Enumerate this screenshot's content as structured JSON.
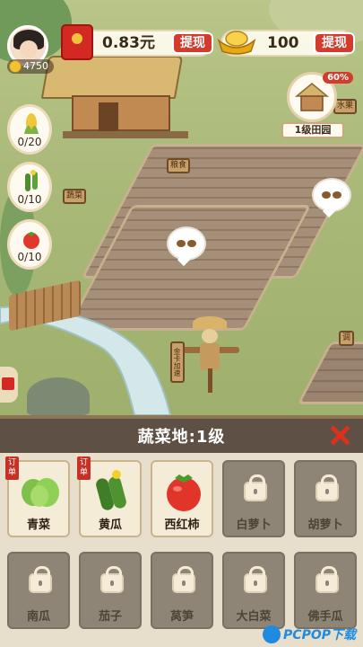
{
  "hud": {
    "gold_count": "4750",
    "cash_amount": "0.83元",
    "cash_withdraw_label": "提现",
    "ingot_amount": "100",
    "ingot_withdraw_label": "提现",
    "crops": [
      {
        "id": "corn",
        "count": "0/20",
        "icon": "corn-icon"
      },
      {
        "id": "cucumber",
        "count": "0/10",
        "icon": "cucumber-icon"
      },
      {
        "id": "tomato",
        "count": "0/10",
        "icon": "tomato-icon"
      }
    ],
    "farm_badge": {
      "percent": "60%",
      "label": "1级田园"
    }
  },
  "scene": {
    "signs": {
      "granary": "粮食",
      "vegetable": "蔬菜",
      "fruit": "水果",
      "scarecrow": "金卡加速",
      "side": "调"
    },
    "colors": {
      "grass": "#a9b978",
      "plot": "#a58f78",
      "water": "#c9e2e6"
    }
  },
  "panel": {
    "title": "蔬菜地:1级",
    "close_icon": "close-icon",
    "order_tag": "订单",
    "crops": [
      {
        "name": "青菜",
        "state": "unlocked",
        "order": true,
        "icon": "bok-choy-icon"
      },
      {
        "name": "黄瓜",
        "state": "unlocked",
        "order": true,
        "icon": "cucumber-icon"
      },
      {
        "name": "西红柿",
        "state": "unlocked",
        "order": false,
        "icon": "tomato-icon"
      },
      {
        "name": "白萝卜",
        "state": "locked",
        "order": false,
        "icon": "radish-icon"
      },
      {
        "name": "胡萝卜",
        "state": "locked",
        "order": false,
        "icon": "carrot-icon"
      },
      {
        "name": "南瓜",
        "state": "locked",
        "order": false,
        "icon": "pumpkin-icon"
      },
      {
        "name": "茄子",
        "state": "locked",
        "order": false,
        "icon": "eggplant-icon"
      },
      {
        "name": "莴笋",
        "state": "locked",
        "order": false,
        "icon": "lettuce-icon"
      },
      {
        "name": "大白菜",
        "state": "locked",
        "order": false,
        "icon": "cabbage-icon"
      },
      {
        "name": "佛手瓜",
        "state": "locked",
        "order": false,
        "icon": "chayote-icon"
      }
    ]
  },
  "watermark": {
    "text": "PCPOP下载"
  }
}
